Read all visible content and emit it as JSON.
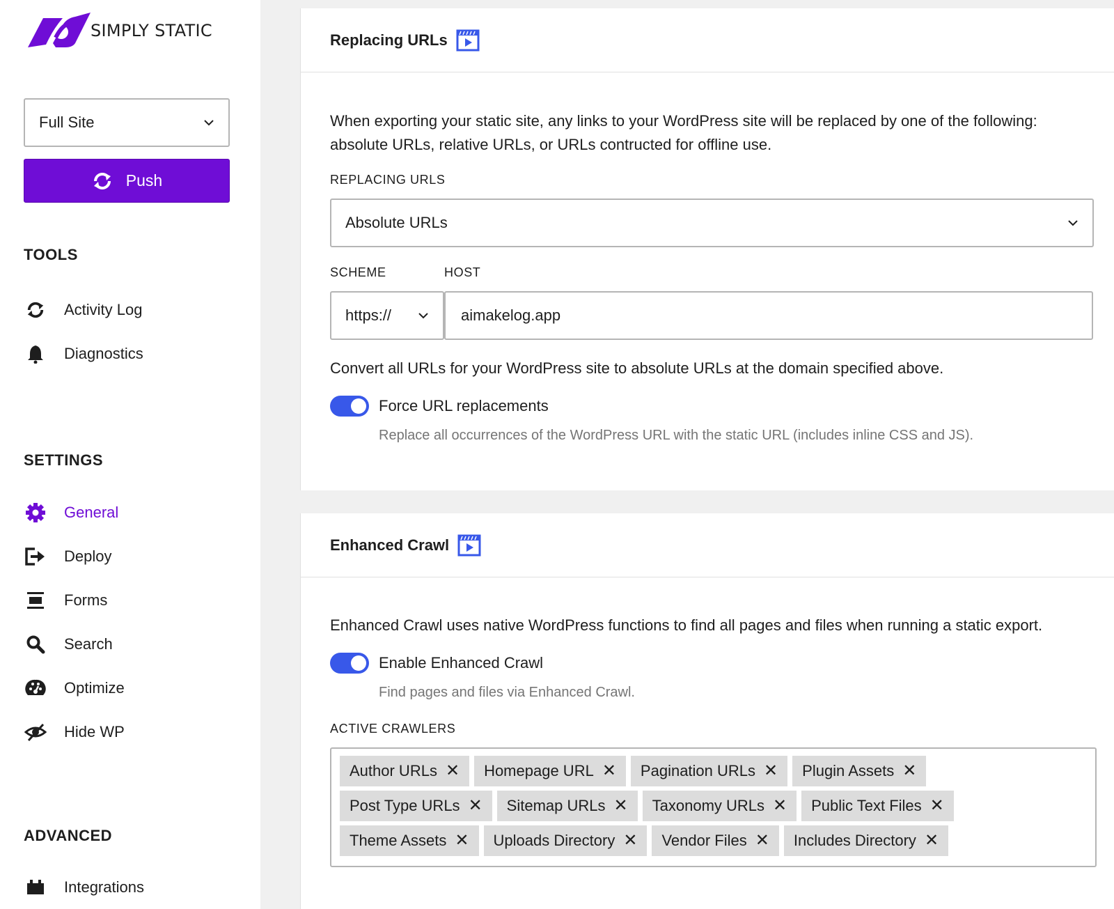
{
  "brand": {
    "name": "SIMPLY STATIC",
    "accent": "#6f0dd6",
    "toggle_color": "#3858e9"
  },
  "sidebar": {
    "site_select": {
      "value": "Full Site"
    },
    "push_label": "Push",
    "tools_heading": "TOOLS",
    "tools": [
      {
        "label": "Activity Log",
        "icon": "sync-icon"
      },
      {
        "label": "Diagnostics",
        "icon": "bell-icon"
      }
    ],
    "settings_heading": "SETTINGS",
    "settings": [
      {
        "label": "General",
        "icon": "gear-icon",
        "active": true
      },
      {
        "label": "Deploy",
        "icon": "exit-icon"
      },
      {
        "label": "Forms",
        "icon": "form-icon"
      },
      {
        "label": "Search",
        "icon": "search-icon"
      },
      {
        "label": "Optimize",
        "icon": "dashboard-icon"
      },
      {
        "label": "Hide WP",
        "icon": "hidden-icon"
      }
    ],
    "advanced_heading": "ADVANCED",
    "advanced": [
      {
        "label": "Integrations",
        "icon": "plugin-icon"
      }
    ]
  },
  "replacing": {
    "title": "Replacing URLs",
    "description": "When exporting your static site, any links to your WordPress site will be replaced by one of the following: absolute URLs, relative URLs, or URLs contructed for offline use.",
    "replacing_label": "REPLACING URLS",
    "replacing_value": "Absolute URLs",
    "scheme_label": "SCHEME",
    "scheme_value": "https://",
    "host_label": "HOST",
    "host_value": "aimakelog.app",
    "convert_text": "Convert all URLs for your WordPress site to absolute URLs at the domain specified above.",
    "force_label": "Force URL replacements",
    "force_help": "Replace all occurrences of the WordPress URL with the static URL (includes inline CSS and JS).",
    "force_enabled": true
  },
  "crawl": {
    "title": "Enhanced Crawl",
    "description": "Enhanced Crawl uses native WordPress functions to find all pages and files when running a static export.",
    "enable_label": "Enable Enhanced Crawl",
    "enable_help": "Find pages and files via Enhanced Crawl.",
    "enabled": true,
    "crawlers_label": "ACTIVE CRAWLERS",
    "crawlers": [
      "Author URLs",
      "Homepage URL",
      "Pagination URLs",
      "Plugin Assets",
      "Post Type URLs",
      "Sitemap URLs",
      "Taxonomy URLs",
      "Public Text Files",
      "Theme Assets",
      "Uploads Directory",
      "Vendor Files",
      "Includes Directory"
    ]
  }
}
